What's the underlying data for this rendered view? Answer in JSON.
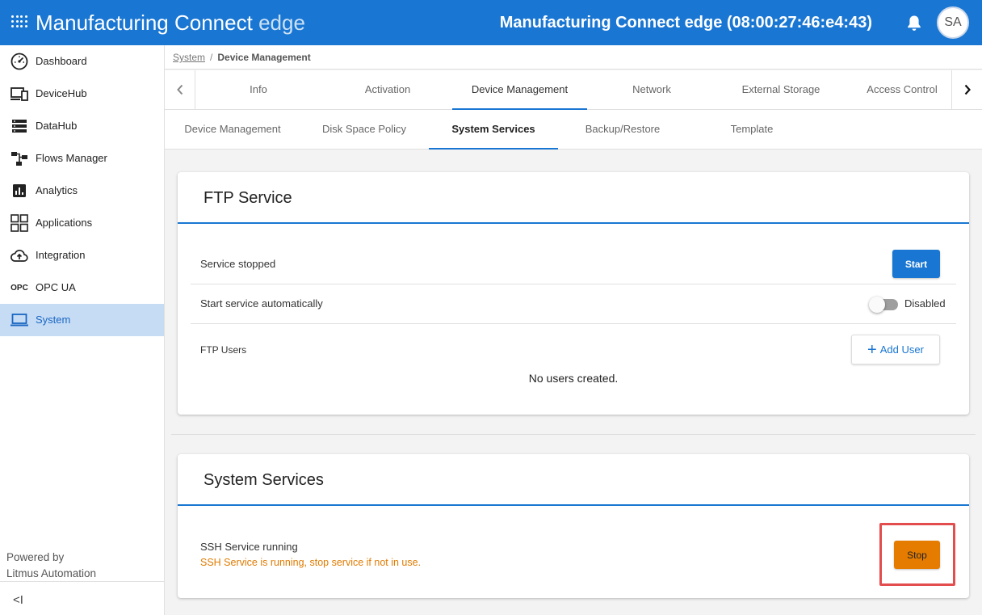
{
  "header": {
    "app_title_main": "Manufacturing Connect",
    "app_title_suffix": "edge",
    "device_title": "Manufacturing Connect edge (08:00:27:46:e4:43)",
    "avatar_initials": "SA"
  },
  "sidebar": {
    "items": [
      {
        "label": "Dashboard",
        "icon": "gauge-icon"
      },
      {
        "label": "DeviceHub",
        "icon": "devices-icon"
      },
      {
        "label": "DataHub",
        "icon": "server-icon"
      },
      {
        "label": "Flows Manager",
        "icon": "flows-icon"
      },
      {
        "label": "Analytics",
        "icon": "analytics-icon"
      },
      {
        "label": "Applications",
        "icon": "apps-grid-icon"
      },
      {
        "label": "Integration",
        "icon": "cloud-upload-icon"
      },
      {
        "label": "OPC UA",
        "icon": "opc-icon",
        "icon_text": "OPC"
      },
      {
        "label": "System",
        "icon": "laptop-icon",
        "active": true
      }
    ],
    "powered_line1": "Powered by",
    "powered_line2": "Litmus Automation",
    "collapse_glyph": "<I"
  },
  "breadcrumb": {
    "parent": "System",
    "separator": "/",
    "current": "Device Management"
  },
  "tabs_primary": {
    "items": [
      "Info",
      "Activation",
      "Device Management",
      "Network",
      "External Storage",
      "Access Control"
    ],
    "active": "Device Management"
  },
  "tabs_secondary": {
    "items": [
      "Device Management",
      "Disk Space Policy",
      "System Services",
      "Backup/Restore",
      "Template"
    ],
    "active": "System Services"
  },
  "ftp_card": {
    "title": "FTP Service",
    "status_text": "Service stopped",
    "start_button": "Start",
    "auto_start_label": "Start service automatically",
    "auto_start_state": "Disabled",
    "auto_start_enabled": false,
    "users_label": "FTP Users",
    "add_user_plus": "+",
    "add_user_button": "Add User",
    "empty_users": "No users created."
  },
  "system_card": {
    "title": "System Services",
    "ssh_status": "SSH Service running",
    "ssh_warning": "SSH Service is running, stop service if not in use.",
    "stop_button": "Stop"
  },
  "colors": {
    "primary": "#1976d2",
    "warning": "#e07b00",
    "stop_button": "#e57c00",
    "highlight": "#e34d4d",
    "active_nav_bg": "#c6dcf5"
  }
}
